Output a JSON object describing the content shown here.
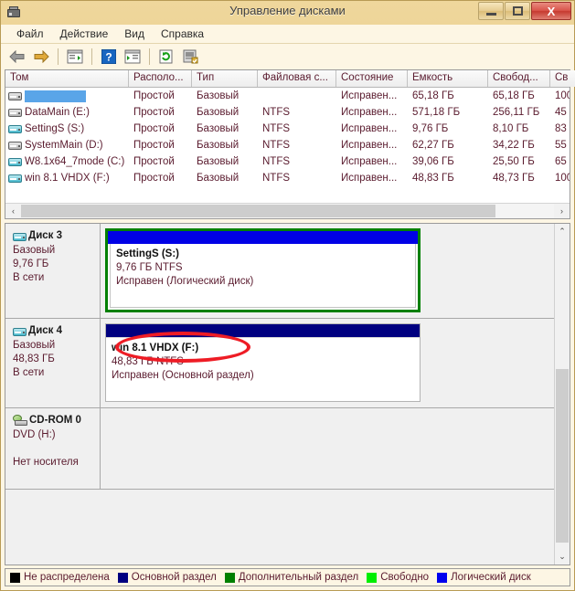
{
  "window": {
    "title": "Управление дисками",
    "app_icon": "disk-management-icon",
    "minimize_label": "–",
    "maximize_label": "□",
    "close_label": "X"
  },
  "menu": {
    "items": [
      {
        "label": "Файл",
        "name": "menu-file"
      },
      {
        "label": "Действие",
        "name": "menu-action"
      },
      {
        "label": "Вид",
        "name": "menu-view"
      },
      {
        "label": "Справка",
        "name": "menu-help"
      }
    ]
  },
  "toolbar": {
    "buttons": [
      {
        "icon": "back-arrow-icon",
        "title": "Назад"
      },
      {
        "icon": "forward-arrow-icon",
        "title": "Вперед"
      },
      {
        "icon": "show-console-tree-icon",
        "title": "Показать или скрыть дерево консоли"
      },
      {
        "icon": "help-icon",
        "title": "Справка"
      },
      {
        "icon": "show-action-pane-icon",
        "title": "Показать или скрыть область действий"
      },
      {
        "icon": "refresh-icon",
        "title": "Обновить"
      },
      {
        "icon": "rescan-disks-icon",
        "title": "Повторить проверку дисков"
      }
    ]
  },
  "volume_list": {
    "columns": [
      {
        "label": "Том",
        "width": 135
      },
      {
        "label": "Располо...",
        "width": 69
      },
      {
        "label": "Тип",
        "width": 72
      },
      {
        "label": "Файловая с...",
        "width": 86
      },
      {
        "label": "Состояние",
        "width": 78
      },
      {
        "label": "Емкость",
        "width": 88
      },
      {
        "label": "Свобод...",
        "width": 68
      },
      {
        "label": "Св",
        "width": 40
      }
    ],
    "rows": [
      {
        "name": "",
        "redacted": true,
        "icon": "gray-drive-icon",
        "layout": "Простой",
        "type": "Базовый",
        "fs": "",
        "status": "Исправен...",
        "capacity": "65,18 ГБ",
        "free": "65,18 ГБ",
        "percent": "100"
      },
      {
        "name": "DataMain (E:)",
        "redacted": false,
        "icon": "gray-drive-icon",
        "layout": "Простой",
        "type": "Базовый",
        "fs": "NTFS",
        "status": "Исправен...",
        "capacity": "571,18 ГБ",
        "free": "256,11 ГБ",
        "percent": "45"
      },
      {
        "name": "SettingS (S:)",
        "redacted": false,
        "icon": "teal-drive-icon",
        "layout": "Простой",
        "type": "Базовый",
        "fs": "NTFS",
        "status": "Исправен...",
        "capacity": "9,76 ГБ",
        "free": "8,10 ГБ",
        "percent": "83"
      },
      {
        "name": "SystemMain (D:)",
        "redacted": false,
        "icon": "gray-drive-icon",
        "layout": "Простой",
        "type": "Базовый",
        "fs": "NTFS",
        "status": "Исправен...",
        "capacity": "62,27 ГБ",
        "free": "34,22 ГБ",
        "percent": "55"
      },
      {
        "name": "W8.1x64_7mode (C:)",
        "redacted": false,
        "icon": "teal-drive-icon",
        "layout": "Простой",
        "type": "Базовый",
        "fs": "NTFS",
        "status": "Исправен...",
        "capacity": "39,06 ГБ",
        "free": "25,50 ГБ",
        "percent": "65"
      },
      {
        "name": "win 8.1 VHDX (F:)",
        "redacted": false,
        "icon": "teal-drive-icon",
        "layout": "Простой",
        "type": "Базовый",
        "fs": "NTFS",
        "status": "Исправен...",
        "capacity": "48,83 ГБ",
        "free": "48,73 ГБ",
        "percent": "100"
      }
    ]
  },
  "disks": [
    {
      "title": "Диск 3",
      "icon": "disk-icon",
      "type": "Базовый",
      "size": "9,76 ГБ",
      "state": "В сети",
      "partition": {
        "style": "extended",
        "bar": "logical",
        "name": "SettingS  (S:)",
        "size_fs": "9,76 ГБ NTFS",
        "status": "Исправен (Логический диск)"
      }
    },
    {
      "title": "Диск 4",
      "icon": "disk-icon",
      "type": "Базовый",
      "size": "48,83 ГБ",
      "state": "В сети",
      "partition": {
        "style": "primary",
        "bar": "primary-bar",
        "name": "win 8.1 VHDX  (F:)",
        "size_fs": "48,83 ГБ NTFS",
        "status": "Исправен (Основной раздел)"
      },
      "annotation": "red-ellipse-highlight"
    },
    {
      "title": "CD-ROM 0",
      "icon": "cdrom-icon",
      "type": "DVD (H:)",
      "size": "",
      "state": "Нет носителя",
      "partition": null
    }
  ],
  "legend": {
    "items": [
      {
        "label": "Не распределена",
        "color": "#000000"
      },
      {
        "label": "Основной раздел",
        "color": "#000080"
      },
      {
        "label": "Дополнительный раздел",
        "color": "#008000"
      },
      {
        "label": "Свободно",
        "color": "#00ee00"
      },
      {
        "label": "Логический диск",
        "color": "#0000ee"
      }
    ]
  },
  "scrollbars": {
    "h_left": "‹",
    "h_right": "›",
    "v_up": "⌃",
    "v_down": "⌄"
  }
}
